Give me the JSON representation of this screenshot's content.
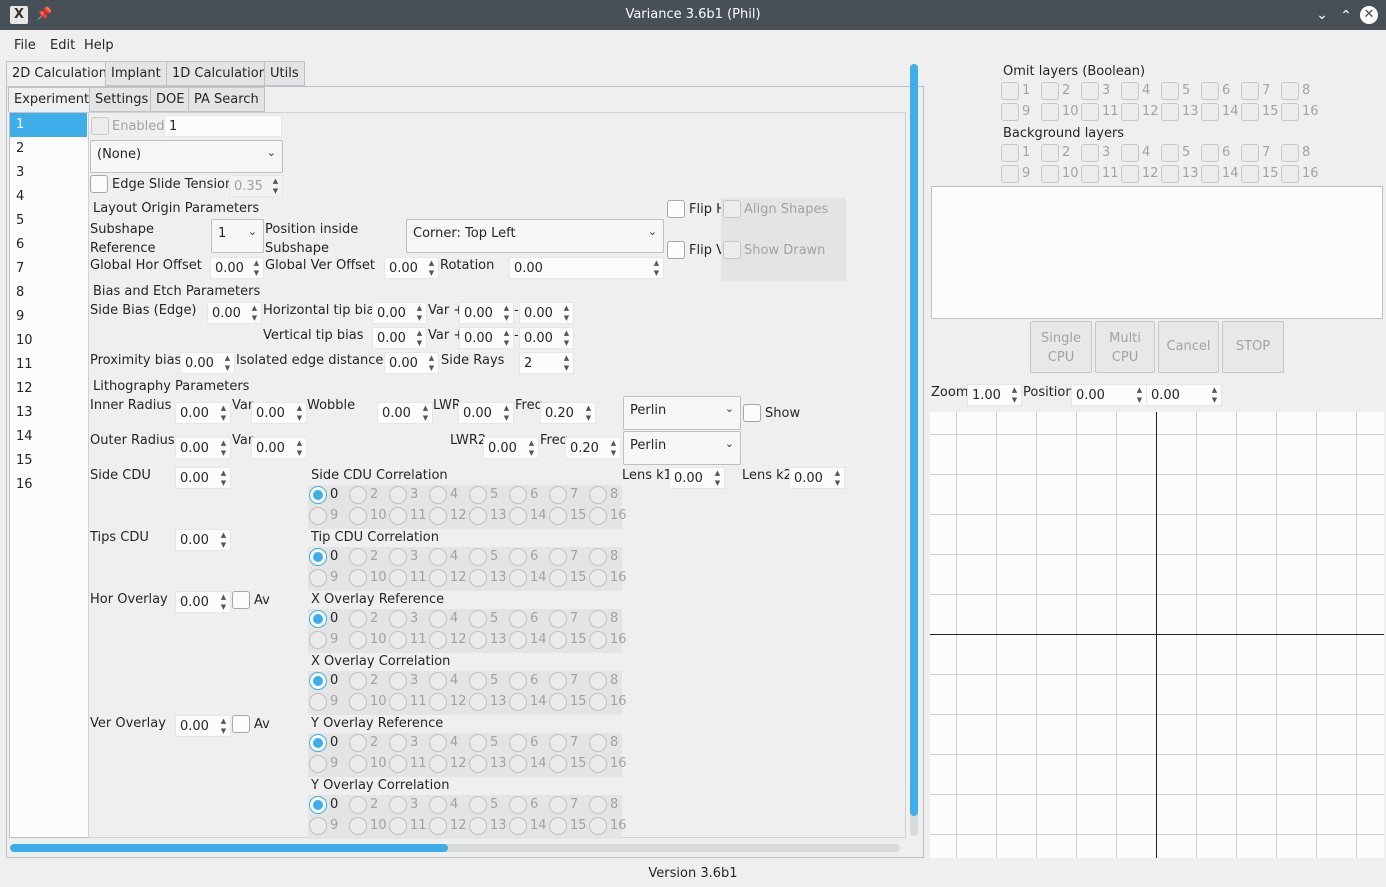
{
  "window": {
    "title": "Variance 3.6b1 (Phil)",
    "icon": "x-app-icon"
  },
  "menu": [
    "File",
    "Edit",
    "Help"
  ],
  "main_tabs": [
    "2D Calculation",
    "Implant",
    "1D Calculation",
    "Utils"
  ],
  "sub_tabs": [
    "Experiment",
    "Settings",
    "DOE",
    "PA Search"
  ],
  "layers": [
    "1",
    "2",
    "3",
    "4",
    "5",
    "6",
    "7",
    "8",
    "9",
    "10",
    "11",
    "12",
    "13",
    "14",
    "15",
    "16"
  ],
  "selected_layer": "1",
  "layer_form": {
    "enabled_label": "Enabled",
    "layer_name": "1",
    "shape_combo": "(None)",
    "edge_slide_tension_label": "Edge Slide Tension",
    "edge_slide_tension": "0.35",
    "layout_origin_title": "Layout Origin Parameters",
    "subshape_reference_label": "Subshape\nReference",
    "subshape_reference_value": "1",
    "position_inside_label": "Position inside\nSubshape",
    "position_inside_value": "Corner: Top Left",
    "flip_h": "Flip H",
    "flip_v": "Flip V",
    "align_shapes": "Align Shapes",
    "show_drawn": "Show Drawn",
    "global_hor_offset_label": "Global Hor Offset",
    "global_hor_offset": "0.00",
    "global_ver_offset_label": "Global Ver Offset",
    "global_ver_offset": "0.00",
    "rotation_label": "Rotation",
    "rotation": "0.00",
    "bias_etch_title": "Bias and Etch Parameters",
    "side_bias_label": "Side Bias (Edge)",
    "side_bias": "0.00",
    "hor_tip_bias_label": "Horizontal tip bias",
    "hor_tip_bias": "0.00",
    "hor_var_plus_label": "Var +",
    "hor_var_plus": "0.00",
    "hor_var_minus_label": "-",
    "hor_var_minus": "0.00",
    "ver_tip_bias_label": "Vertical tip bias",
    "ver_tip_bias": "0.00",
    "ver_var_plus_label": "Var +",
    "ver_var_plus": "0.00",
    "ver_var_minus_label": "-",
    "ver_var_minus": "0.00",
    "proximity_bias_label": "Proximity bias",
    "proximity_bias": "0.00",
    "isolated_edge_label": "Isolated edge distance",
    "isolated_edge": "0.00",
    "side_rays_label": "Side Rays",
    "side_rays": "2",
    "litho_title": "Lithography Parameters",
    "inner_radius_label": "Inner Radius",
    "inner_radius": "0.00",
    "inner_var_label": "Var",
    "inner_var": "0.00",
    "wobble_label": "Wobble",
    "wobble": "0.00",
    "lwr_label": "LWR",
    "lwr": "0.00",
    "freq1_label": "Freq",
    "freq1": "0.20",
    "noise1": "Perlin",
    "show_label": "Show",
    "outer_radius_label": "Outer Radius",
    "outer_radius": "0.00",
    "outer_var_label": "Var",
    "outer_var": "0.00",
    "lwr2_label": "LWR2",
    "lwr2": "0.00",
    "freq2_label": "Freq",
    "freq2": "0.20",
    "noise2": "Perlin",
    "side_cdu_label": "Side CDU",
    "side_cdu": "0.00",
    "lens_k1_label": "Lens k1",
    "lens_k1": "0.00",
    "lens_k2_label": "Lens k2",
    "lens_k2": "0.00",
    "tips_cdu_label": "Tips CDU",
    "tips_cdu": "0.00",
    "hor_overlay_label": "Hor Overlay",
    "hor_overlay": "0.00",
    "av1_label": "Av",
    "ver_overlay_label": "Ver Overlay",
    "ver_overlay": "0.00",
    "av2_label": "Av"
  },
  "correlations": [
    {
      "title": "Side CDU Correlation",
      "selected": "0"
    },
    {
      "title": "Tip CDU Correlation",
      "selected": "0"
    },
    {
      "title": "X Overlay Reference",
      "selected": "0"
    },
    {
      "title": "X Overlay Correlation",
      "selected": "0"
    },
    {
      "title": "Y Overlay Reference",
      "selected": "0"
    },
    {
      "title": "Y Overlay Correlation",
      "selected": "0"
    }
  ],
  "correlation_options": [
    "0",
    "2",
    "3",
    "4",
    "5",
    "6",
    "7",
    "8",
    "9",
    "10",
    "11",
    "12",
    "13",
    "14",
    "15",
    "16"
  ],
  "omit_layers_title": "Omit layers (Boolean)",
  "background_layers_title": "Background layers",
  "layer_checkbox_labels": [
    "1",
    "2",
    "3",
    "4",
    "5",
    "6",
    "7",
    "8",
    "9",
    "10",
    "11",
    "12",
    "13",
    "14",
    "15",
    "16"
  ],
  "buttons": {
    "single_cpu": "Single\nCPU",
    "multi_cpu": "Multi\nCPU",
    "cancel": "Cancel",
    "stop": "STOP"
  },
  "viewport": {
    "zoom_label": "Zoom",
    "zoom": "1.00",
    "position_label": "Position",
    "pos_x": "0.00",
    "pos_y": "0.00"
  },
  "status": "Version 3.6b1",
  "colors": {
    "titlebar": "#475057",
    "accent": "#3daee9",
    "background": "#efefef"
  }
}
